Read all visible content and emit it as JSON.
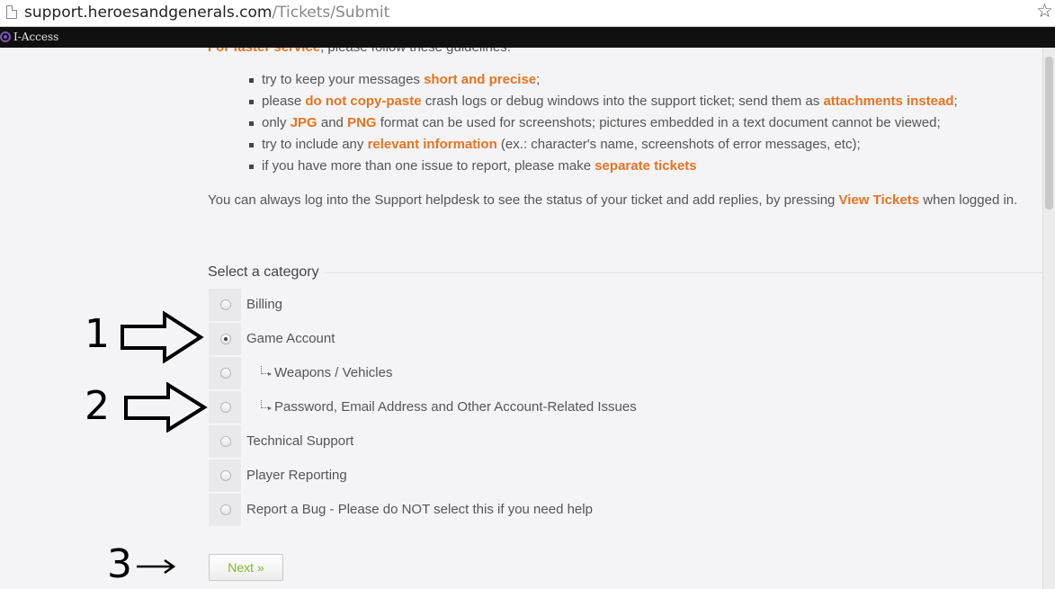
{
  "browser": {
    "url_host": "support.heroesandgenerals.com",
    "url_path": "/Tickets/Submit",
    "bookmark_label": "I-Access"
  },
  "intro": {
    "cut_lead": "For faster service",
    "cut_rest": ", please follow these guidelines:"
  },
  "guidelines": [
    {
      "pre": "try to keep your messages ",
      "hl": "short and precise",
      "post": ";"
    },
    {
      "pre": "please ",
      "hl": "do not copy-paste",
      "mid": " crash logs or debug windows into the support ticket; send them as ",
      "hl2": "attachments instead",
      "post": ";"
    },
    {
      "pre": "only ",
      "hl": "JPG",
      "mid": " and ",
      "hl2": "PNG",
      "post": " format can be used for screenshots; pictures embedded in a text document cannot be viewed;"
    },
    {
      "pre": "try to include any ",
      "hl": "relevant information",
      "post": " (ex.: character's name, screenshots of error messages, etc);"
    },
    {
      "pre": "if you have more than one issue to report, please make ",
      "hl": "separate tickets",
      "post": ""
    }
  ],
  "status_note": {
    "pre": "You can always log into the Support helpdesk to see the status of your ticket and add replies, by pressing ",
    "link": "View Tickets",
    "post": " when logged in."
  },
  "category": {
    "heading": "Select a category",
    "options": [
      {
        "label": "Billing"
      },
      {
        "label": "Game Account"
      },
      {
        "label": "Weapons / Vehicles"
      },
      {
        "label": "Password, Email Address and Other Account-Related Issues"
      },
      {
        "label": "Technical Support"
      },
      {
        "label": "Player Reporting"
      },
      {
        "label": "Report a Bug - Please do NOT select this if you need help"
      }
    ],
    "selected": "Game Account"
  },
  "next_label": "Next »",
  "annotations": [
    "1",
    "2",
    "3"
  ]
}
